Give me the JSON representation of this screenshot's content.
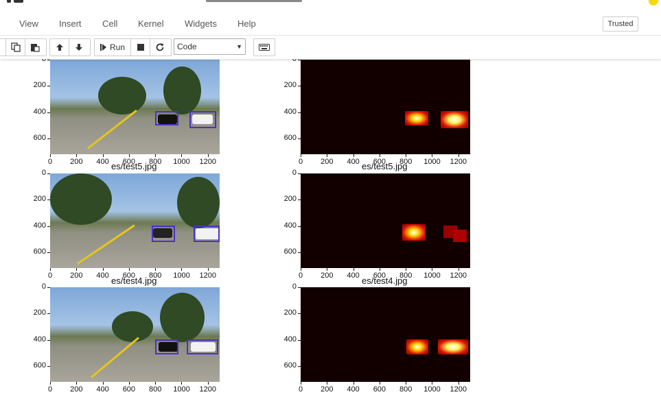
{
  "menu": {
    "items": [
      "View",
      "Insert",
      "Cell",
      "Kernel",
      "Widgets",
      "Help"
    ],
    "trusted_label": "Trusted"
  },
  "toolbar": {
    "run_label": "Run",
    "cell_type": "Code",
    "icons": [
      "copy-icon",
      "paste-icon",
      "arrow-up-icon",
      "arrow-down-icon",
      "step-forward-icon",
      "stop-icon",
      "restart-icon",
      "keyboard-icon"
    ]
  },
  "figure": {
    "y_ticks": [
      "0",
      "200",
      "400",
      "600"
    ],
    "x_ticks": [
      "0",
      "200",
      "400",
      "600",
      "800",
      "1000",
      "1200"
    ],
    "rows": [
      {
        "title": ""
      },
      {
        "title": "es/test5.jpg"
      },
      {
        "title": "es/test4.jpg"
      }
    ]
  },
  "colors": {
    "bbox": "#4a2fd0",
    "heat_background": "#120000"
  }
}
